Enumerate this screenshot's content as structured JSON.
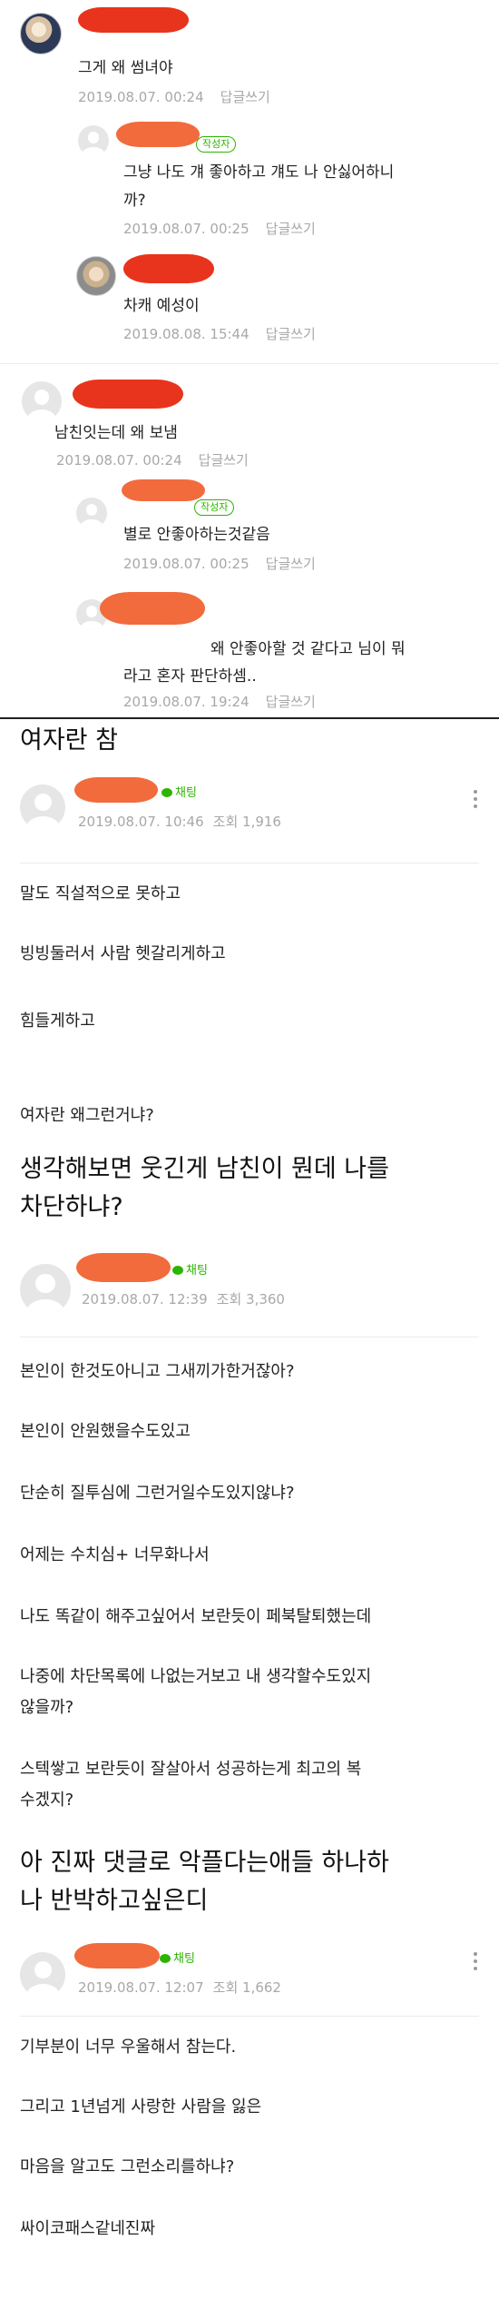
{
  "comments": [
    {
      "text": "그게 왜 썸녀야",
      "date": "2019.08.07. 00:24",
      "reply": "답글쓰기"
    },
    {
      "badge": "작성자",
      "text_lines": [
        "그냥 나도 걔 좋아하고 걔도 나 안싫어하니",
        "까?"
      ],
      "date": "2019.08.07. 00:25",
      "reply": "답글쓰기"
    },
    {
      "text": "차캐 예성이",
      "date": "2019.08.08. 15:44",
      "reply": "답글쓰기"
    },
    {
      "text": "남친잇는데 왜 보냄",
      "date": "2019.08.07. 00:24",
      "reply": "답글쓰기"
    },
    {
      "badge": "작성자",
      "text": "별로 안좋아하는것같음",
      "date": "2019.08.07. 00:25",
      "reply": "답글쓰기"
    },
    {
      "text_lines": [
        "왜 안좋아할 것 같다고 님이 뭐",
        "라고 혼자 판단하셈.."
      ],
      "date": "2019.08.07. 19:24",
      "reply": "답글쓰기"
    }
  ],
  "posts": [
    {
      "title_lines": [
        "여자란 참"
      ],
      "chat": "채팅",
      "date": "2019.08.07. 10:46",
      "views": "조회 1,916",
      "body": [
        "말도 직설적으로 못하고",
        "빙빙둘러서 사람 헷갈리게하고",
        "힘들게하고",
        "여자란 왜그런거냐?"
      ]
    },
    {
      "title_lines": [
        "생각해보면 웃긴게 남친이 뭔데 나를",
        "차단하냐?"
      ],
      "chat": "채팅",
      "date": "2019.08.07. 12:39",
      "views": "조회 3,360",
      "body": [
        "본인이 한것도아니고 그새끼가한거잖아?",
        "본인이 안원했을수도있고",
        "단순히 질투심에 그런거일수도있지않냐?",
        "어제는 수치심+ 너무화나서",
        "나도 똑같이 해주고싶어서 보란듯이 페북탈퇴했는데",
        "나중에 차단목록에 나없는거보고 내 생각할수도있지",
        "않을까?",
        "스텍쌓고 보란듯이 잘살아서 성공하는게 최고의 복",
        "수겠지?"
      ]
    },
    {
      "title_lines": [
        "아 진짜 댓글로 악플다는애들 하나하",
        "나 반박하고싶은디"
      ],
      "chat": "채팅",
      "date": "2019.08.07. 12:07",
      "views": "조회 1,662",
      "body": [
        "기부분이 너무 우울해서 참는다.",
        "그리고 1년넘게 사랑한 사람을 잃은",
        "마음을 알고도 그런소리를하냐?",
        "싸이코패스같네진짜"
      ]
    }
  ],
  "colors": {
    "accent_green": "#2db400",
    "redaction_red": "#e8341c",
    "redaction_orange": "#f26b3d"
  }
}
